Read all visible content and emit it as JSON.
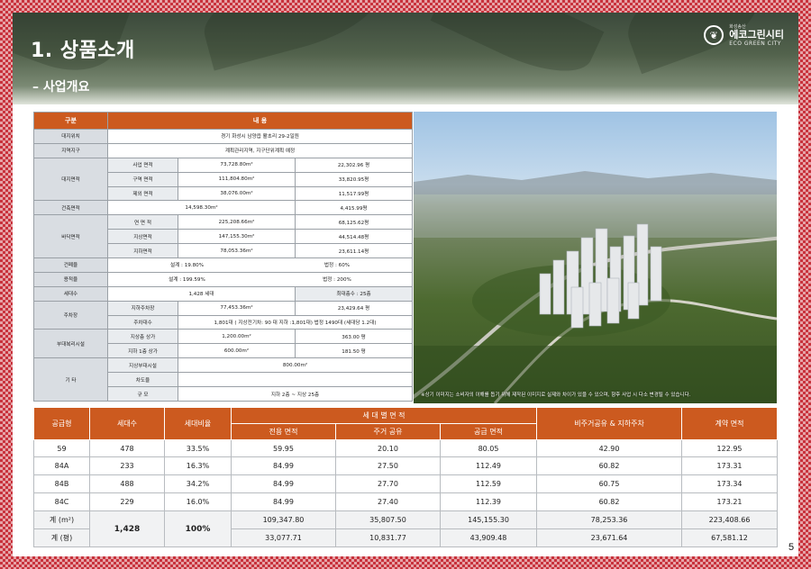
{
  "header": {
    "title": "1. 상품소개",
    "subtitle": "– 사업개요",
    "logo_top": "화성송산",
    "logo_name": "에코그린시티",
    "logo_sub": "ECO GREEN CITY"
  },
  "info_table": {
    "head_col1": "구분",
    "head_col2": "내    용",
    "site_location": {
      "label": "대지위치",
      "value": "경기 화성시 남양읍 활초리 29-2일원"
    },
    "zone": {
      "label": "지역지구",
      "value": "계획관리지역, 지구단위계획 예정"
    },
    "site_area": {
      "label": "대지면적",
      "rows": [
        {
          "label": "사업 면적",
          "m2": "73,728.80m²",
          "py": "22,302.96 평"
        },
        {
          "label": "구역 면적",
          "m2": "111,804.80m²",
          "py": "33,820.95평"
        },
        {
          "label": "제외 면적",
          "m2": "38,076.00m²",
          "py": "11,517.99평"
        }
      ]
    },
    "building_area": {
      "label": "건축면적",
      "m2": "14,598.30m²",
      "py": "4,415.99평"
    },
    "floor_area": {
      "label": "바닥면적",
      "rows": [
        {
          "label": "연 면 적",
          "m2": "225,208.66m²",
          "py": "68,125.62평"
        },
        {
          "label": "지상면적",
          "m2": "147,155.30m²",
          "py": "44,514.48평"
        },
        {
          "label": "지하면적",
          "m2": "78,053.36m²",
          "py": "23,611.14평"
        }
      ]
    },
    "coverage": {
      "label": "건폐율",
      "design_label": "설계 :",
      "design": "19.80%",
      "legal_label": "법정 :",
      "legal": "60%"
    },
    "far": {
      "label": "용적율",
      "design_label": "설계 :",
      "design": "199.59%",
      "legal_label": "법정 :",
      "legal": "200%"
    },
    "households": {
      "label": "세대수",
      "value": "1,428 세대",
      "floors": "최대층수 : 25층"
    },
    "parking": {
      "label": "주차장",
      "area_label": "지하주차장",
      "area_m2": "77,453.36m²",
      "area_py": "23,429.64 평",
      "count_label": "주차대수",
      "count_value": "1,801대 ( 지상전기차: 90 대 지하 :1,801대)  법정  1490대 (세대당 1.2대)"
    },
    "facilities": {
      "label": "부대복리시설",
      "rows": [
        {
          "label": "지상층 상가",
          "m2": "1,200.00m²",
          "py": "363.00 평"
        },
        {
          "label": "지하 1층 상가",
          "m2": "600.00m²",
          "py": "181.50 평"
        }
      ]
    },
    "etc": {
      "label": "기    타",
      "rows": [
        {
          "label": "지상부대시설",
          "value": "800.00m²"
        },
        {
          "label": "차도율",
          "value": ""
        },
        {
          "label": "규  모",
          "value": "지하 2층 ~ 지상 25층"
        }
      ]
    }
  },
  "photo": {
    "caption": "※상기 이미지는 소비자의 이해를 돕기 위해 제작된 이미지로 실제와 차이가 있을 수 있으며, 향후 사업 시 다소 변경될 수 있습니다."
  },
  "supply_table": {
    "headers": {
      "type": "공급형",
      "units": "세대수",
      "ratio": "세대비율",
      "area_group": "세 대 별 면 적",
      "exclusive": "전용 면적",
      "common": "주거 공유",
      "supply": "공급 면적",
      "non_residential": "비주거공유 & 지하주차",
      "contract": "계약 면적"
    },
    "rows": [
      {
        "type": "59",
        "units": "478",
        "ratio": "33.5%",
        "exclusive": "59.95",
        "common": "20.10",
        "supply": "80.05",
        "non_residential": "42.90",
        "contract": "122.95"
      },
      {
        "type": "84A",
        "units": "233",
        "ratio": "16.3%",
        "exclusive": "84.99",
        "common": "27.50",
        "supply": "112.49",
        "non_residential": "60.82",
        "contract": "173.31"
      },
      {
        "type": "84B",
        "units": "488",
        "ratio": "34.2%",
        "exclusive": "84.99",
        "common": "27.70",
        "supply": "112.59",
        "non_residential": "60.75",
        "contract": "173.34"
      },
      {
        "type": "84C",
        "units": "229",
        "ratio": "16.0%",
        "exclusive": "84.99",
        "common": "27.40",
        "supply": "112.39",
        "non_residential": "60.82",
        "contract": "173.21"
      }
    ],
    "total_units": "1,428",
    "total_ratio": "100%",
    "total_m2": {
      "label": "계 (m²)",
      "exclusive": "109,347.80",
      "common": "35,807.50",
      "supply": "145,155.30",
      "non_residential": "78,253.36",
      "contract": "223,408.66"
    },
    "total_py": {
      "label": "계 (평)",
      "exclusive": "33,077.71",
      "common": "10,831.77",
      "supply": "43,909.48",
      "non_residential": "23,671.64",
      "contract": "67,581.12"
    }
  },
  "page_number": "5",
  "colors": {
    "accent": "#cc5a1f",
    "border_pattern": "#c8323c",
    "header_green": "#52624c"
  }
}
